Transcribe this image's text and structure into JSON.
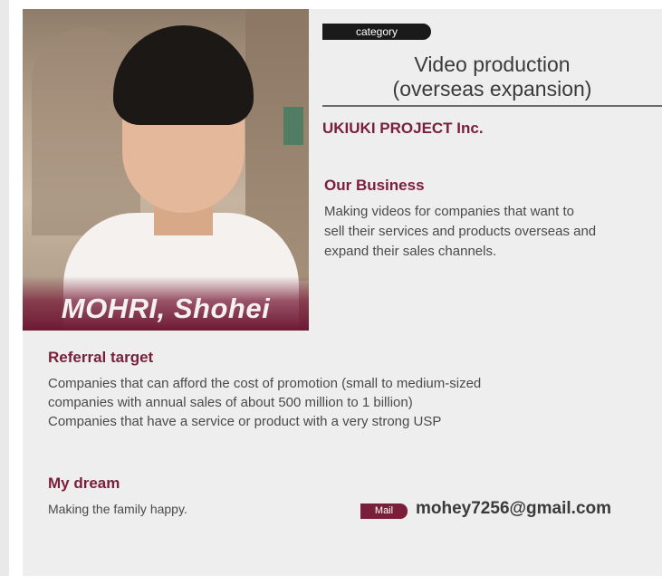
{
  "profile": {
    "name": "MOHRI, Shohei",
    "category_label": "category",
    "category_title_line1": "Video production",
    "category_title_line2": "(overseas expansion)",
    "company": "UKIUKI PROJECT Inc."
  },
  "business": {
    "heading": "Our Business",
    "lines": [
      "Making videos for companies that want to",
      "sell their services and products overseas and",
      "expand their sales channels."
    ]
  },
  "referral": {
    "heading": "Referral target",
    "lines": [
      "Companies that can afford the cost of promotion (small to medium-sized",
      "companies with annual sales of about 500 million to 1 billion)",
      "Companies that have a service or product with a very strong USP"
    ]
  },
  "dream": {
    "heading": "My dream",
    "text": "Making the family happy."
  },
  "contact": {
    "mail_label": "Mail",
    "email": "mohey7256@gmail.com"
  },
  "colors": {
    "accent": "#7a1f3a",
    "card_bg": "#eeeeee",
    "badge_dark": "#1a1a1a"
  }
}
